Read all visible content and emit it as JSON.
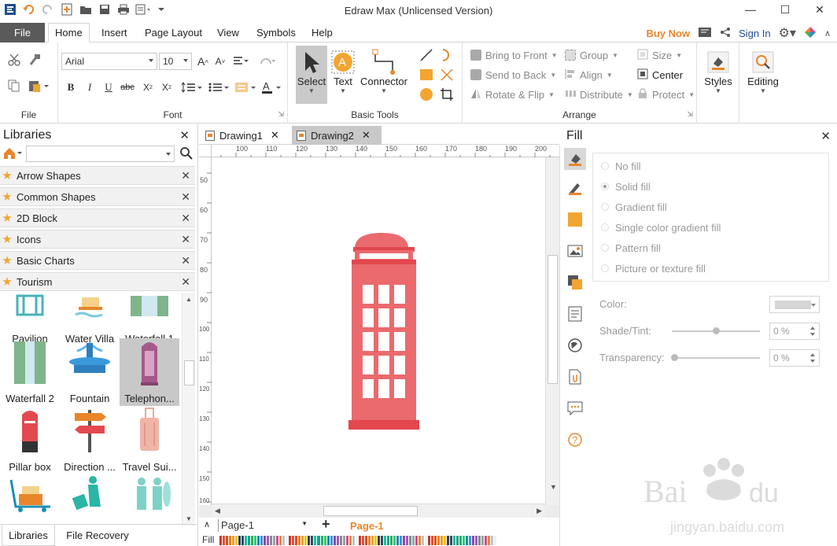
{
  "app": {
    "title": "Edraw Max (Unlicensed Version)"
  },
  "ribbon": {
    "tabs": [
      "File",
      "Home",
      "Insert",
      "Page Layout",
      "View",
      "Symbols",
      "Help"
    ],
    "buy_now": "Buy Now",
    "sign_in": "Sign In",
    "font": {
      "family": "Arial",
      "size": "10",
      "group_label": "Font"
    },
    "file_group_label": "File",
    "basic_tools": {
      "select": "Select",
      "text": "Text",
      "connector": "Connector",
      "group_label": "Basic Tools"
    },
    "arrange": {
      "bring_to_front": "Bring to Front",
      "send_to_back": "Send to Back",
      "rotate_flip": "Rotate & Flip",
      "group": "Group",
      "align": "Align",
      "distribute": "Distribute",
      "size": "Size",
      "center": "Center",
      "protect": "Protect",
      "group_label": "Arrange"
    },
    "styles": "Styles",
    "editing": "Editing"
  },
  "libraries": {
    "title": "Libraries",
    "categories": [
      "Arrow Shapes",
      "Common Shapes",
      "2D Block",
      "Icons",
      "Basic Charts",
      "Tourism"
    ],
    "shapes": [
      "Pavilion",
      "Water Villa",
      "Waterfall 1",
      "Waterfall 2",
      "Fountain",
      "Telephon...",
      "Pillar box",
      "Direction ...",
      "Travel Sui..."
    ],
    "bottom_tabs": [
      "Libraries",
      "File Recovery"
    ]
  },
  "documents": {
    "tabs": [
      "Drawing1",
      "Drawing2"
    ]
  },
  "ruler": {
    "h_ticks": [
      "100",
      "110",
      "120",
      "130",
      "140",
      "150",
      "160",
      "170",
      "180",
      "190",
      "200"
    ],
    "v_ticks": [
      "50",
      "60",
      "70",
      "80",
      "90",
      "100",
      "110",
      "120",
      "130",
      "140",
      "150",
      "160"
    ]
  },
  "pages": {
    "selector": "Page-1",
    "active": "Page-1",
    "add": "+"
  },
  "fill_bar_label": "Fill",
  "fill_panel": {
    "title": "Fill",
    "options": [
      "No fill",
      "Solid fill",
      "Gradient fill",
      "Single color gradient fill",
      "Pattern fill",
      "Picture or texture fill"
    ],
    "selected_option": "Solid fill",
    "color_label": "Color:",
    "shade_label": "Shade/Tint:",
    "shade_value": "0 %",
    "transparency_label": "Transparency:",
    "transparency_value": "0 %"
  },
  "colors": {
    "accent_orange": "#e8862a",
    "phonebox_red": "#ea6a6e",
    "phonebox_dark": "#e2474d"
  }
}
